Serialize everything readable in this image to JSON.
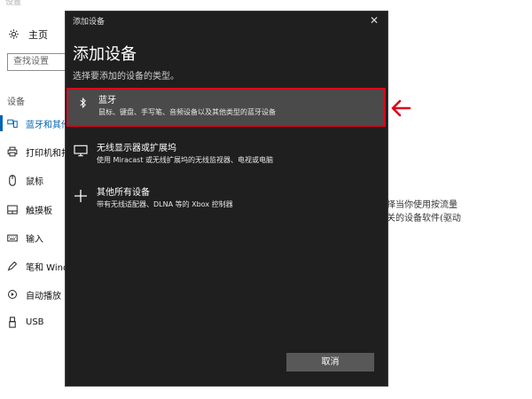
{
  "settings": {
    "window_title": "设置",
    "home_label": "主页",
    "search_placeholder": "查找设置",
    "section_label": "设备",
    "nav_items": [
      {
        "label": "蓝牙和其他",
        "icon": "bluetooth-device-icon"
      },
      {
        "label": "打印机和扫",
        "icon": "printer-icon"
      },
      {
        "label": "鼠标",
        "icon": "mouse-icon"
      },
      {
        "label": "触摸板",
        "icon": "touchpad-icon"
      },
      {
        "label": "输入",
        "icon": "keyboard-icon"
      },
      {
        "label": "笔和 Wind",
        "icon": "pen-icon"
      },
      {
        "label": "自动播放",
        "icon": "autoplay-icon"
      },
      {
        "label": "USB",
        "icon": "usb-icon"
      }
    ],
    "side_lines": [
      "择当你使用按流量",
      "关的设备软件(驱动"
    ]
  },
  "dialog": {
    "title": "添加设备",
    "heading": "添加设备",
    "subtitle": "选择要添加的设备的类型。",
    "options": [
      {
        "title": "蓝牙",
        "desc": "鼠标、键盘、手写笔、音频设备以及其他类型的蓝牙设备",
        "icon": "bluetooth-icon",
        "selected": true
      },
      {
        "title": "无线显示器或扩展坞",
        "desc": "使用 Miracast 或无线扩展坞的无线监视器、电视或电脑",
        "icon": "monitor-icon",
        "selected": false
      },
      {
        "title": "其他所有设备",
        "desc": "带有无线适配器、DLNA 等的 Xbox 控制器",
        "icon": "plus-icon",
        "selected": false
      }
    ],
    "cancel_label": "取消",
    "close_glyph": "✕"
  },
  "colors": {
    "accent": "#0063b1",
    "highlight": "#e0001a",
    "dialog_bg": "#1f1f1f"
  }
}
